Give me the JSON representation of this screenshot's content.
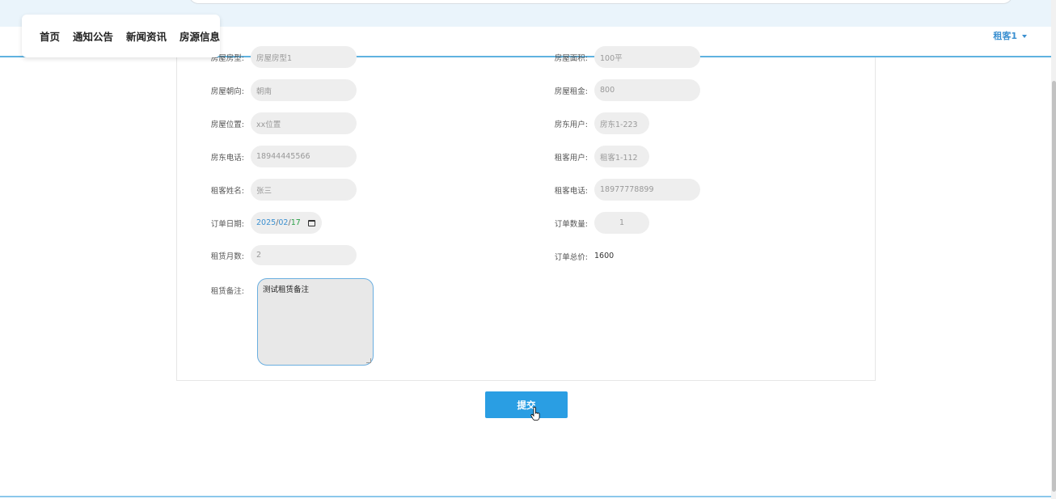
{
  "nav": {
    "items": [
      {
        "label": "首页"
      },
      {
        "label": "通知公告"
      },
      {
        "label": "新闻资讯"
      },
      {
        "label": "房源信息"
      }
    ],
    "user": "租客1"
  },
  "form": {
    "left": [
      {
        "label": "房屋房型:",
        "value": "房屋房型1"
      },
      {
        "label": "房屋朝向:",
        "value": "朝南"
      },
      {
        "label": "房屋位置:",
        "value": "xx位置"
      },
      {
        "label": "房东电话:",
        "value": "18944445566"
      },
      {
        "label": "租客姓名:",
        "value": "张三"
      },
      {
        "label": "订单日期:",
        "date_year": "2025",
        "date_month": "02",
        "date_day": "17",
        "date_sep": "/"
      },
      {
        "label": "租赁月数:",
        "value": "2"
      },
      {
        "label": "租赁备注:",
        "value": "测试租赁备注"
      }
    ],
    "right": [
      {
        "label": "房屋面积:",
        "value": "100平"
      },
      {
        "label": "房屋租金:",
        "value": "800"
      },
      {
        "label": "房东用户:",
        "value": "房东1-223"
      },
      {
        "label": "租客用户:",
        "value": "租客1-112"
      },
      {
        "label": "租客电话:",
        "value": "18977778899"
      },
      {
        "label": "订单数量:",
        "value": "1"
      },
      {
        "label": "订单总价:",
        "value": "1600"
      }
    ],
    "submit_label": "提交"
  },
  "icons": {
    "calendar": "calendar-icon",
    "caret": "chevron-down-icon",
    "cursor": "hand-pointer-icon"
  },
  "colors": {
    "accent": "#2a9ee3",
    "nav_border": "#5fb2e0",
    "field_bg": "#eeeeee"
  }
}
